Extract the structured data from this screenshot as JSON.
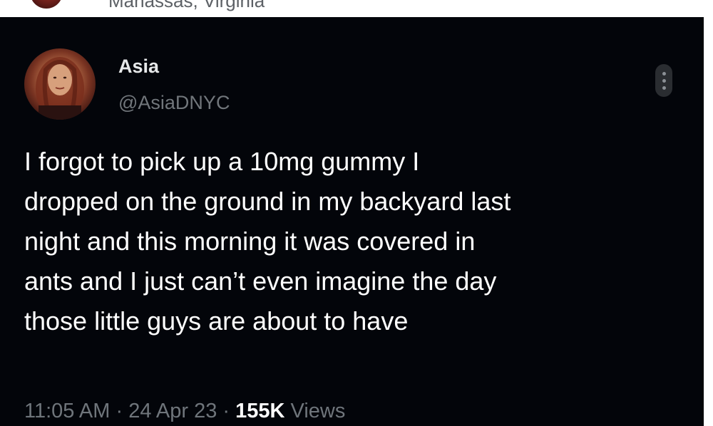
{
  "header": {
    "location": "Manassas, Virginia"
  },
  "author": {
    "display_name": "Asia",
    "handle": "@AsiaDNYC",
    "avatar_icon": "profile-photo",
    "more_icon": "more-options-icon"
  },
  "tweet": {
    "lines": [
      "I forgot to pick up a 10mg gummy I",
      "dropped on the ground in my backyard last",
      "night and this morning it was covered in",
      "ants and I just can’t even imagine the day",
      "those little guys are about to have"
    ]
  },
  "meta": {
    "time": "11:05 AM",
    "separator": "·",
    "date": "24 Apr 23",
    "views_count": "155K",
    "views_label": "Views"
  },
  "colors": {
    "background": "#03050a",
    "text_primary": "#ffffff",
    "text_secondary": "#71767b"
  }
}
